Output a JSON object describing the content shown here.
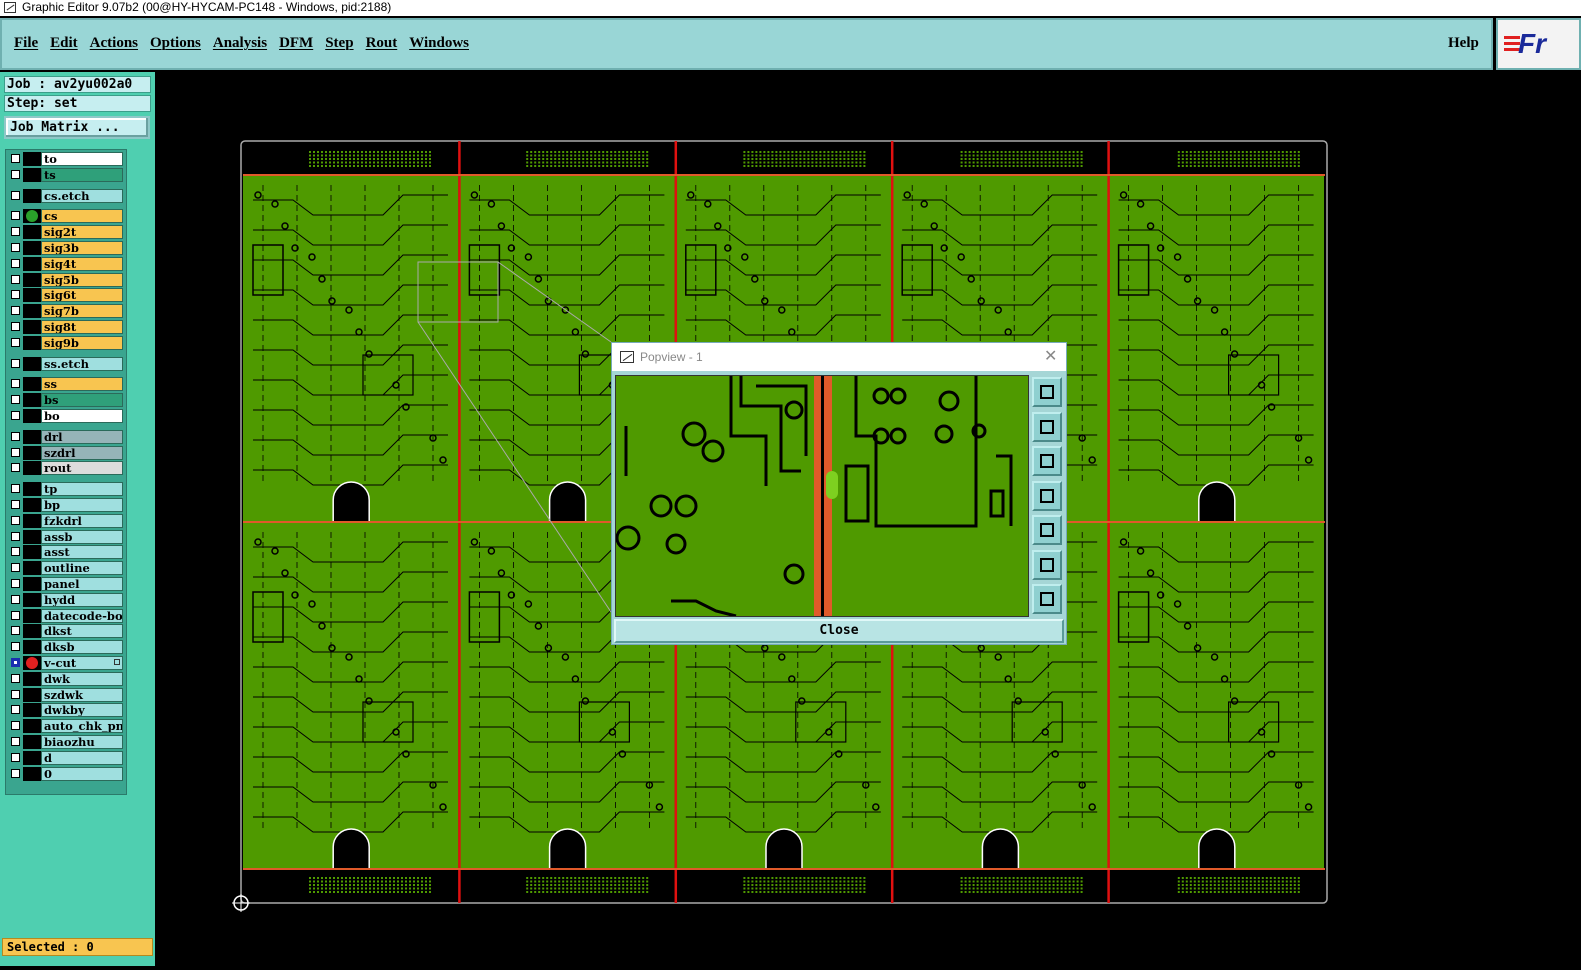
{
  "window": {
    "title": "Graphic Editor 9.07b2 (00@HY-HYCAM-PC148 - Windows, pid:2188)"
  },
  "menu": {
    "items": [
      "File",
      "Edit",
      "Actions",
      "Options",
      "Analysis",
      "DFM",
      "Step",
      "Rout",
      "Windows"
    ],
    "help": "Help"
  },
  "logo": {
    "text": "Fr"
  },
  "job": {
    "label": "Job : av2yu002a0",
    "step": "Step: set",
    "matrix_button": "Job Matrix ..."
  },
  "layers": [
    {
      "name": "to",
      "color": "#ffffff"
    },
    {
      "name": "ts",
      "color": "#2fa07a"
    },
    {
      "name": "cs.etch",
      "color": "#9fdfdf",
      "gap_before": true
    },
    {
      "name": "cs",
      "color": "#f8c550",
      "gap_before": true,
      "dot": "#2aa02a"
    },
    {
      "name": "sig2t",
      "color": "#f8c550"
    },
    {
      "name": "sig3b",
      "color": "#f8c550"
    },
    {
      "name": "sig4t",
      "color": "#f8c550"
    },
    {
      "name": "sig5b",
      "color": "#f8c550"
    },
    {
      "name": "sig6t",
      "color": "#f8c550"
    },
    {
      "name": "sig7b",
      "color": "#f8c550"
    },
    {
      "name": "sig8t",
      "color": "#f8c550"
    },
    {
      "name": "sig9b",
      "color": "#f8c550"
    },
    {
      "name": "ss.etch",
      "color": "#9fdfdf",
      "gap_before": true
    },
    {
      "name": "ss",
      "color": "#f8c550",
      "gap_before": true
    },
    {
      "name": "bs",
      "color": "#2fa07a"
    },
    {
      "name": "bo",
      "color": "#ffffff"
    },
    {
      "name": "drl",
      "color": "#96b4b8",
      "gap_before": true
    },
    {
      "name": "szdrl",
      "color": "#96b4b8"
    },
    {
      "name": "rout",
      "color": "#dcdcdc"
    },
    {
      "name": "tp",
      "color": "#9fdfdf",
      "gap_before": true
    },
    {
      "name": "bp",
      "color": "#9fdfdf"
    },
    {
      "name": "fzkdrl",
      "color": "#9fdfdf"
    },
    {
      "name": "assb",
      "color": "#9fdfdf"
    },
    {
      "name": "asst",
      "color": "#9fdfdf"
    },
    {
      "name": "outline",
      "color": "#9fdfdf"
    },
    {
      "name": "panel",
      "color": "#9fdfdf"
    },
    {
      "name": "hydd",
      "color": "#9fdfdf"
    },
    {
      "name": "datecode-bo",
      "color": "#9fdfdf"
    },
    {
      "name": "dkst",
      "color": "#9fdfdf"
    },
    {
      "name": "dksb",
      "color": "#9fdfdf"
    },
    {
      "name": "v-cut",
      "color": "#9fdfdf",
      "dot": "#e02020",
      "checked": true,
      "marker": true
    },
    {
      "name": "dwk",
      "color": "#9fdfdf"
    },
    {
      "name": "szdwk",
      "color": "#9fdfdf"
    },
    {
      "name": "dwkby",
      "color": "#9fdfdf"
    },
    {
      "name": "auto_chk_pn",
      "color": "#9fdfdf"
    },
    {
      "name": "biaozhu",
      "color": "#9fdfdf"
    },
    {
      "name": "d",
      "color": "#9fdfdf"
    },
    {
      "name": "0",
      "color": "#9fdfdf"
    }
  ],
  "status": {
    "selected": "Selected : 0"
  },
  "board": {
    "cols": 5,
    "rows": 2,
    "pcb_color": "#4f9a00",
    "vcut_color": "#e01010"
  },
  "popview": {
    "title": "Popview - 1",
    "close_label": "Close",
    "tools": [
      "zoom-fit-icon",
      "pan-up-icon",
      "pan-down-icon",
      "pan-left-icon",
      "pan-right-icon",
      "zoom-out-icon",
      "zoom-in-icon"
    ]
  }
}
